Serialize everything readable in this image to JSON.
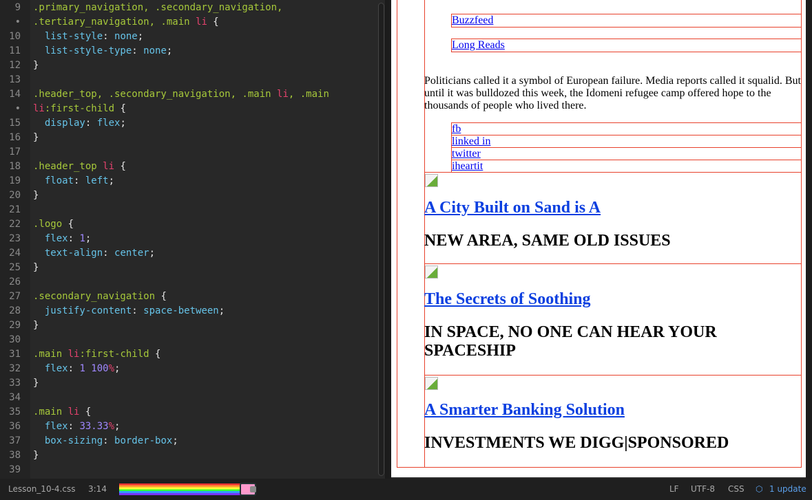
{
  "editor": {
    "lines": [
      {
        "n": "9",
        "t": [
          [
            ".primary_navigation, .secondary_navigation,",
            "sel"
          ]
        ]
      },
      {
        "n": "•",
        "t": [
          [
            ".tertiary_navigation, .main ",
            "sel"
          ],
          [
            "li",
            "tag"
          ],
          [
            " {",
            "pun"
          ]
        ]
      },
      {
        "n": "10",
        "t": [
          [
            "  list-style",
            "prop"
          ],
          [
            ": ",
            "pun"
          ],
          [
            "none",
            "val"
          ],
          [
            ";",
            "pun"
          ]
        ]
      },
      {
        "n": "11",
        "t": [
          [
            "  list-style-type",
            "prop"
          ],
          [
            ": ",
            "pun"
          ],
          [
            "none",
            "val"
          ],
          [
            ";",
            "pun"
          ]
        ]
      },
      {
        "n": "12",
        "t": [
          [
            "}",
            "pun"
          ]
        ]
      },
      {
        "n": "13",
        "t": []
      },
      {
        "n": "14",
        "t": [
          [
            ".header_top, .secondary_navigation, .main ",
            "sel"
          ],
          [
            "li",
            "tag"
          ],
          [
            ", .main",
            "sel"
          ]
        ]
      },
      {
        "n": "•",
        "t": [
          [
            "li",
            "tag"
          ],
          [
            ":first-child",
            "sel"
          ],
          [
            " {",
            "pun"
          ]
        ]
      },
      {
        "n": "15",
        "t": [
          [
            "  display",
            "prop"
          ],
          [
            ": ",
            "pun"
          ],
          [
            "flex",
            "val"
          ],
          [
            ";",
            "pun"
          ]
        ]
      },
      {
        "n": "16",
        "t": [
          [
            "}",
            "pun"
          ]
        ]
      },
      {
        "n": "17",
        "t": []
      },
      {
        "n": "18",
        "t": [
          [
            ".header_top ",
            "sel"
          ],
          [
            "li",
            "tag"
          ],
          [
            " {",
            "pun"
          ]
        ]
      },
      {
        "n": "19",
        "t": [
          [
            "  float",
            "prop"
          ],
          [
            ": ",
            "pun"
          ],
          [
            "left",
            "val"
          ],
          [
            ";",
            "pun"
          ]
        ]
      },
      {
        "n": "20",
        "t": [
          [
            "}",
            "pun"
          ]
        ]
      },
      {
        "n": "21",
        "t": []
      },
      {
        "n": "22",
        "t": [
          [
            ".logo",
            "sel"
          ],
          [
            " {",
            "pun"
          ]
        ]
      },
      {
        "n": "23",
        "t": [
          [
            "  flex",
            "prop"
          ],
          [
            ": ",
            "pun"
          ],
          [
            "1",
            "num"
          ],
          [
            ";",
            "pun"
          ]
        ]
      },
      {
        "n": "24",
        "t": [
          [
            "  text-align",
            "prop"
          ],
          [
            ": ",
            "pun"
          ],
          [
            "center",
            "val"
          ],
          [
            ";",
            "pun"
          ]
        ]
      },
      {
        "n": "25",
        "t": [
          [
            "}",
            "pun"
          ]
        ]
      },
      {
        "n": "26",
        "t": []
      },
      {
        "n": "27",
        "t": [
          [
            ".secondary_navigation",
            "sel"
          ],
          [
            " {",
            "pun"
          ]
        ]
      },
      {
        "n": "28",
        "t": [
          [
            "  justify-content",
            "prop"
          ],
          [
            ": ",
            "pun"
          ],
          [
            "space-between",
            "val"
          ],
          [
            ";",
            "pun"
          ]
        ]
      },
      {
        "n": "29",
        "t": [
          [
            "}",
            "pun"
          ]
        ]
      },
      {
        "n": "30",
        "t": []
      },
      {
        "n": "31",
        "t": [
          [
            ".main ",
            "sel"
          ],
          [
            "li",
            "tag"
          ],
          [
            ":first-child",
            "sel"
          ],
          [
            " {",
            "pun"
          ]
        ]
      },
      {
        "n": "32",
        "t": [
          [
            "  flex",
            "prop"
          ],
          [
            ": ",
            "pun"
          ],
          [
            "1 100",
            "num"
          ],
          [
            "%",
            "tag"
          ],
          [
            ";",
            "pun"
          ]
        ]
      },
      {
        "n": "33",
        "t": [
          [
            "}",
            "pun"
          ]
        ]
      },
      {
        "n": "34",
        "t": []
      },
      {
        "n": "35",
        "t": [
          [
            ".main ",
            "sel"
          ],
          [
            "li",
            "tag"
          ],
          [
            " {",
            "pun"
          ]
        ]
      },
      {
        "n": "36",
        "t": [
          [
            "  flex",
            "prop"
          ],
          [
            ": ",
            "pun"
          ],
          [
            "33.33",
            "num"
          ],
          [
            "%",
            "tag"
          ],
          [
            ";",
            "pun"
          ]
        ]
      },
      {
        "n": "37",
        "t": [
          [
            "  box-sizing",
            "prop"
          ],
          [
            ": ",
            "pun"
          ],
          [
            "border-box",
            "val"
          ],
          [
            ";",
            "pun"
          ]
        ]
      },
      {
        "n": "38",
        "t": [
          [
            "}",
            "pun"
          ]
        ]
      },
      {
        "n": "39",
        "t": []
      }
    ]
  },
  "preview": {
    "nav_links": [
      "Buzzfeed",
      "Long Reads"
    ],
    "paragraph": "Politicians called it a symbol of European failure. Media reports called it squalid. But until it was bulldozed this week, the Idomeni refugee camp offered hope to the thousands of people who lived there.",
    "social_links": [
      "fb",
      "linked in",
      "twitter",
      "iheartit"
    ],
    "articles": [
      {
        "title": "A City Built on Sand is A",
        "subtitle": "NEW AREA, SAME OLD ISSUES"
      },
      {
        "title": "The Secrets of Soothing",
        "subtitle": "IN SPACE, NO ONE CAN HEAR YOUR SPACESHIP"
      },
      {
        "title": "A Smarter Banking Solution",
        "subtitle": "INVESTMENTS WE DIGG|SPONSORED"
      }
    ]
  },
  "status": {
    "file": "Lesson_10-4.css",
    "cursor": "3:14",
    "line_ending": "LF",
    "encoding": "UTF-8",
    "grammar": "CSS",
    "updates": "1 update",
    "accent": "#5b9fea"
  }
}
